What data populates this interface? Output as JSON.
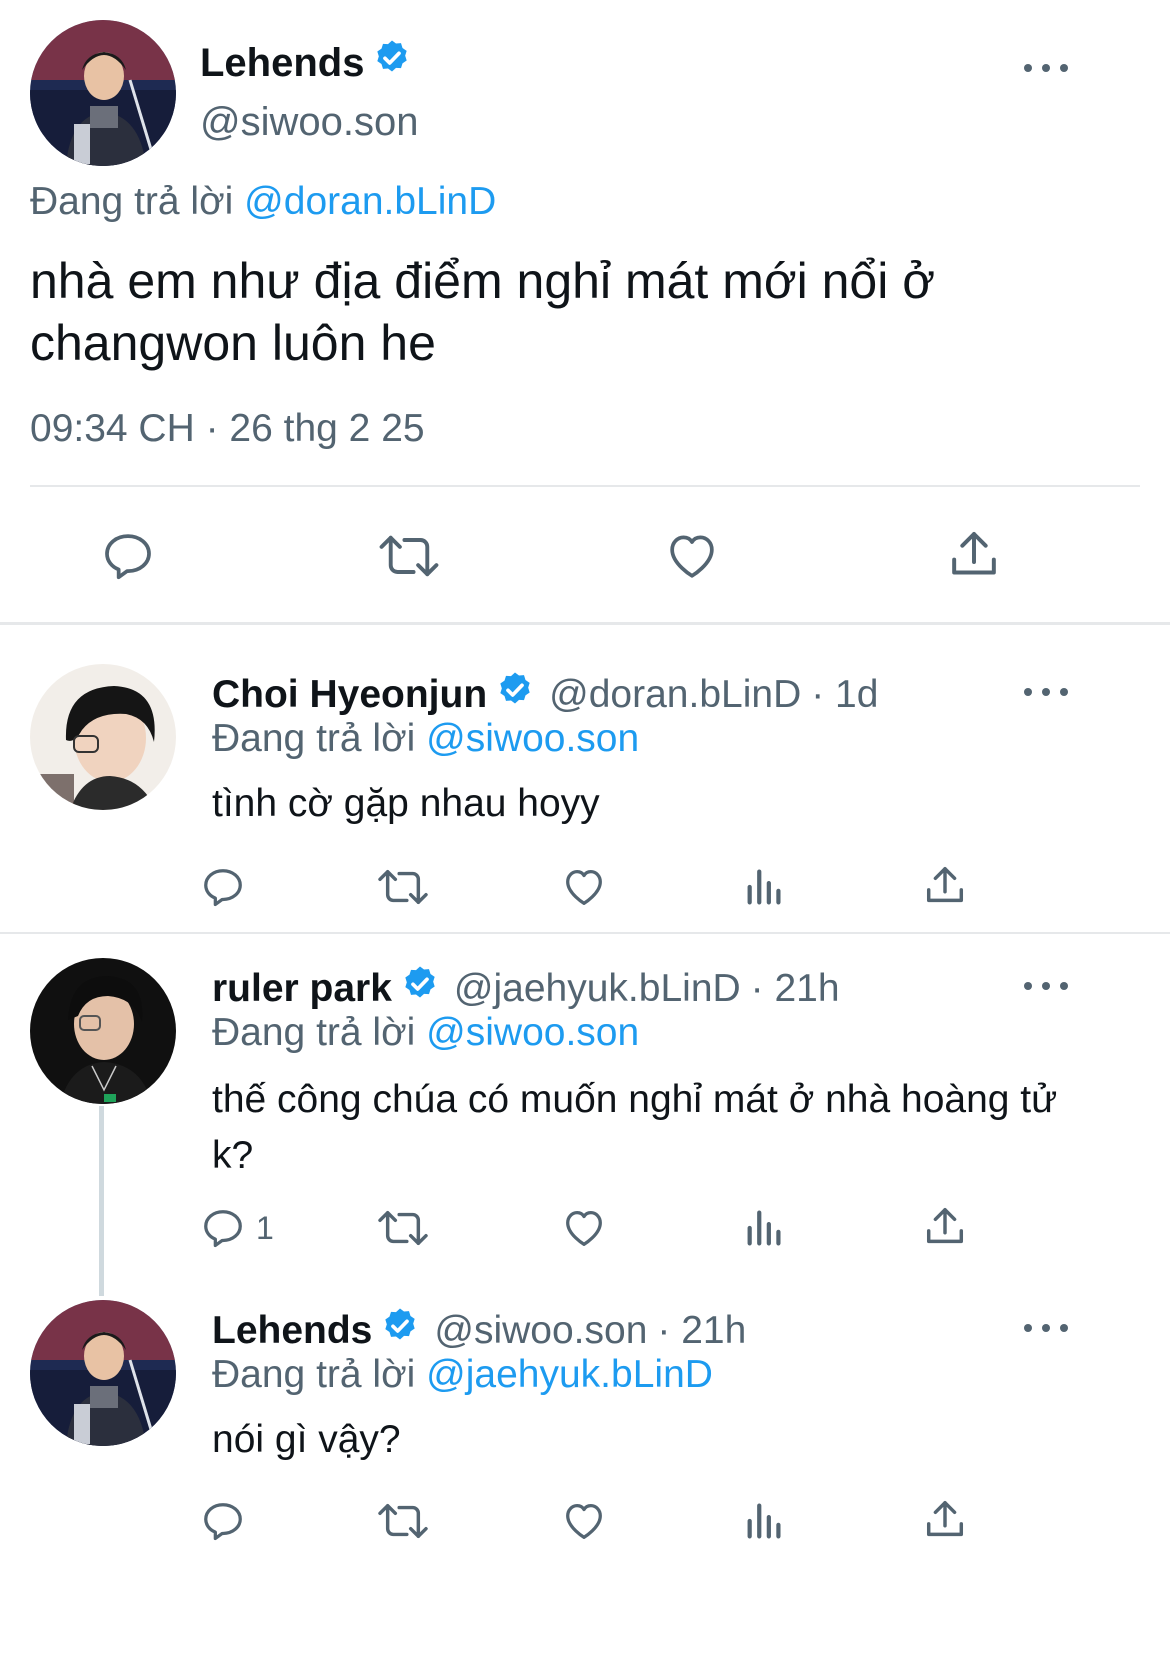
{
  "main_tweet": {
    "name": "Lehends",
    "handle": "@siwoo.son",
    "replying_prefix": "Đang trả lời",
    "replying_to": "@doran.bLinD",
    "text": "nhà em như địa điểm nghỉ mát mới nổi ở changwon luôn he",
    "timestamp": "09:34 CH · 26 thg 2 25"
  },
  "replies": [
    {
      "name": "Choi Hyeonjun",
      "handle": "@doran.bLinD",
      "time": "· 1d",
      "replying_prefix": "Đang trả lời",
      "replying_to": "@siwoo.son",
      "text": "tình cờ gặp nhau hoyy",
      "reply_count": ""
    },
    {
      "name": "ruler park",
      "handle": "@jaehyuk.bLinD",
      "time": "· 21h",
      "replying_prefix": "Đang trả lời",
      "replying_to": "@siwoo.son",
      "text": "thế công chúa có muốn nghỉ mát ở nhà hoàng tử k?",
      "reply_count": "1"
    },
    {
      "name": "Lehends",
      "handle": "@siwoo.son",
      "time": "· 21h",
      "replying_prefix": "Đang trả lời",
      "replying_to": "@jaehyuk.bLinD",
      "text": "nói gì vậy?",
      "reply_count": ""
    }
  ],
  "icons": {
    "verified": "verified-badge-icon",
    "more": "more-horizontal-icon",
    "reply": "reply-bubble-icon",
    "retweet": "retweet-icon",
    "like": "heart-icon",
    "views": "views-bar-chart-icon",
    "share": "share-upload-icon"
  },
  "colors": {
    "accent": "#1d9bf0",
    "muted": "#536471",
    "text": "#0f1419",
    "divider": "#e6e8ea"
  }
}
